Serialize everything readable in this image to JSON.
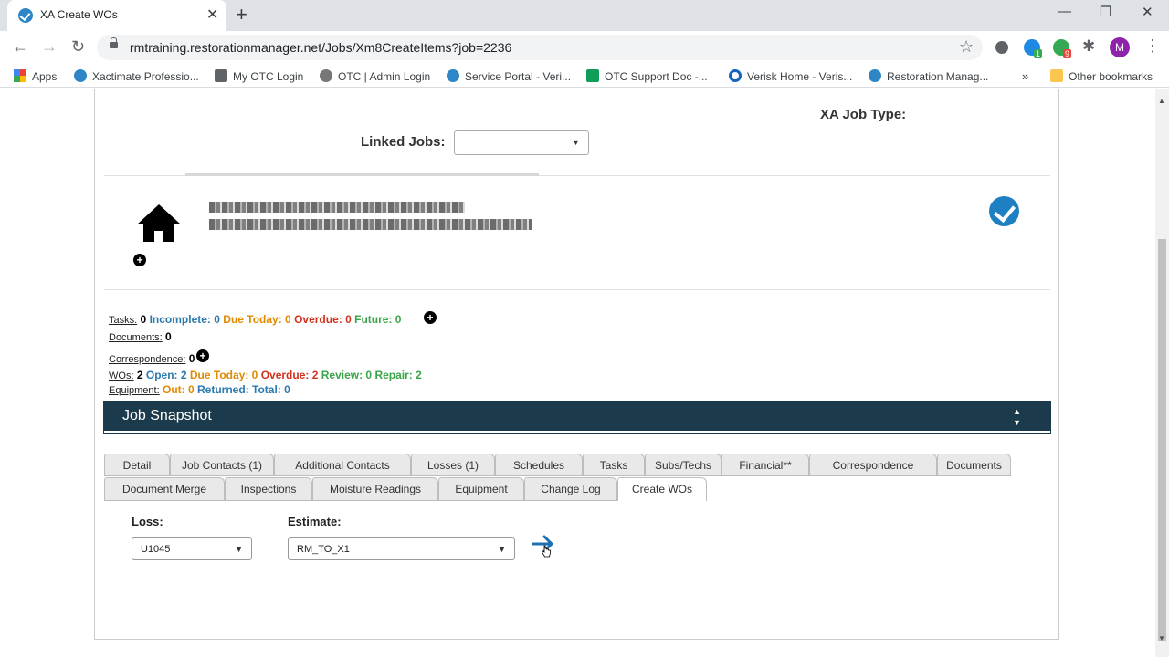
{
  "browser": {
    "tab_title": "XA Create WOs",
    "url": "rmtraining.restorationmanager.net/Jobs/Xm8CreateItems?job=2236",
    "profile_initial": "M",
    "ext_badges": [
      "1",
      "9"
    ],
    "bookmarks": [
      {
        "label": "Apps"
      },
      {
        "label": "Xactimate Professio..."
      },
      {
        "label": "My OTC Login"
      },
      {
        "label": "OTC | Admin Login"
      },
      {
        "label": "Service Portal - Veri..."
      },
      {
        "label": "OTC Support Doc -..."
      },
      {
        "label": "Verisk Home - Veris..."
      },
      {
        "label": "Restoration Manag..."
      }
    ],
    "overflow": "»",
    "other_bookmarks": "Other bookmarks"
  },
  "header": {
    "xa_job_type_label": "XA Job Type:",
    "linked_jobs_label": "Linked Jobs:",
    "linked_jobs_value": ""
  },
  "stats": {
    "tasks": {
      "label": "Tasks:",
      "count": "0",
      "incomplete": "Incomplete: 0",
      "due_today": "Due Today: 0",
      "overdue": "Overdue: 0",
      "future": "Future: 0"
    },
    "documents": {
      "label": "Documents:",
      "count": "0"
    },
    "correspondence": {
      "label": "Correspondence:",
      "count": "0"
    },
    "wos": {
      "label": "WOs:",
      "count": "2",
      "open": "Open: 2",
      "due_today": "Due Today: 0",
      "overdue": "Overdue: 2",
      "review": "Review: 0",
      "repair": "Repair: 2"
    },
    "equipment": {
      "label": "Equipment:",
      "out": "Out: 0",
      "returned": "Returned:",
      "total": "Total: 0"
    }
  },
  "snapshot": {
    "title": "Job Snapshot"
  },
  "tabs_row1": [
    "Detail",
    "Job Contacts (1)",
    "Additional Contacts",
    "Losses (1)",
    "Schedules",
    "Tasks",
    "Subs/Techs",
    "Financial**",
    "Correspondence",
    "Documents"
  ],
  "tabs_row2": [
    "Document Merge",
    "Inspections",
    "Moisture Readings",
    "Equipment",
    "Change Log",
    "Create WOs"
  ],
  "active_tab": "Create WOs",
  "form": {
    "loss_label": "Loss:",
    "loss_value": "U1045",
    "estimate_label": "Estimate:",
    "estimate_value": "RM_TO_X1"
  },
  "colors": {
    "snapshot_bar": "#1b3a4b",
    "blue": "#2a7ab0",
    "orange": "#e08a00",
    "red": "#d0321e",
    "green": "#3aa54a"
  }
}
